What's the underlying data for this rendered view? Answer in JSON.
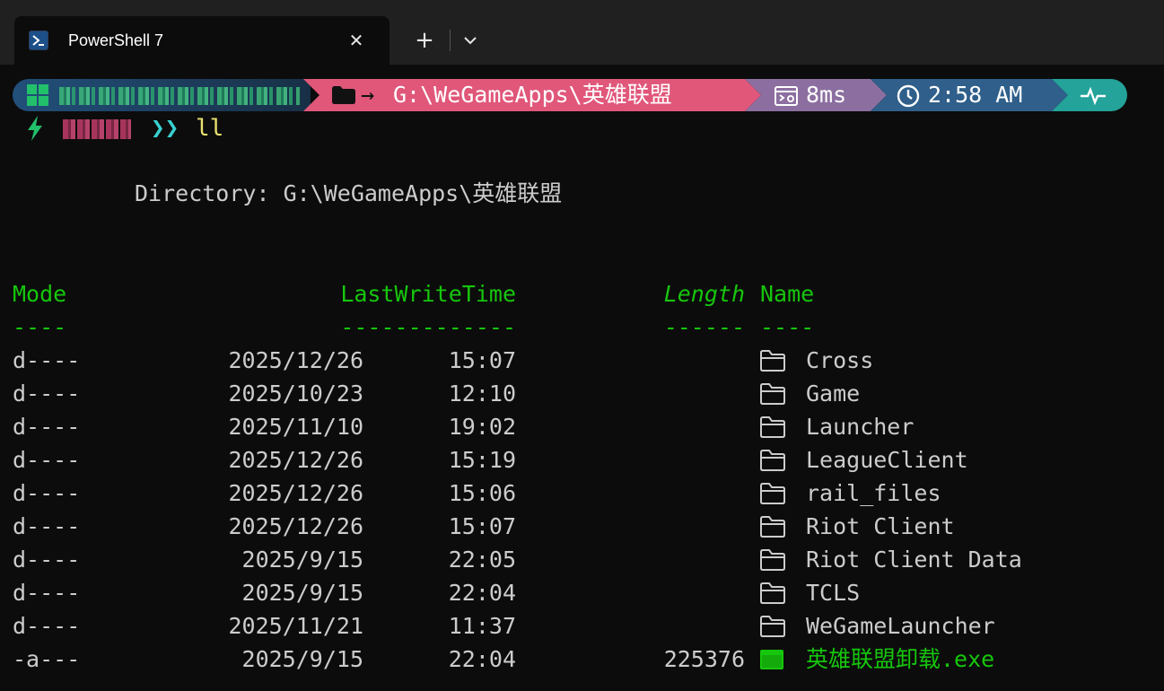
{
  "window": {
    "tab_title": "PowerShell 7",
    "tab_icon": "powershell-icon",
    "close_icon": "close-icon",
    "new_tab_icon": "plus-icon",
    "dropdown_icon": "chevron-down-icon"
  },
  "prompt": {
    "segment_host": {
      "icon": "windows-icon",
      "color": "#1d3c5c"
    },
    "segment_path": {
      "icon": "folder-icon",
      "arrow": "→",
      "path": "G:\\WeGameApps\\英雄联盟",
      "color": "#e0577a"
    },
    "segment_duration": {
      "icon": "execution-time-icon",
      "value": "8ms",
      "color": "#8c6fa0"
    },
    "segment_time": {
      "icon": "clock-icon",
      "value": "2:58 AM",
      "color": "#2f5f8a"
    },
    "segment_status": {
      "icon": "pulse-icon",
      "color": "#23a39a"
    }
  },
  "command": {
    "icon": "lightning-icon",
    "chevrons": "❯❯",
    "text": "ll"
  },
  "listing": {
    "directory_line": "Directory: G:\\WeGameApps\\英雄联盟",
    "headers": {
      "mode": "Mode",
      "lastwritetime": "LastWriteTime",
      "length": "Length",
      "name": "Name"
    },
    "underlines": {
      "mode": "----",
      "lastwritetime": "-------------",
      "length": "------",
      "name": "----"
    },
    "rows": [
      {
        "mode": "d----",
        "date": "2025/12/26",
        "time": "15:07",
        "length": "",
        "type": "folder",
        "name": "Cross"
      },
      {
        "mode": "d----",
        "date": "2025/10/23",
        "time": "12:10",
        "length": "",
        "type": "folder",
        "name": "Game"
      },
      {
        "mode": "d----",
        "date": "2025/11/10",
        "time": "19:02",
        "length": "",
        "type": "folder",
        "name": "Launcher"
      },
      {
        "mode": "d----",
        "date": "2025/12/26",
        "time": "15:19",
        "length": "",
        "type": "folder",
        "name": "LeagueClient"
      },
      {
        "mode": "d----",
        "date": "2025/12/26",
        "time": "15:06",
        "length": "",
        "type": "folder",
        "name": "rail_files"
      },
      {
        "mode": "d----",
        "date": "2025/12/26",
        "time": "15:07",
        "length": "",
        "type": "folder",
        "name": "Riot Client"
      },
      {
        "mode": "d----",
        "date": "2025/9/15",
        "time": "22:05",
        "length": "",
        "type": "folder",
        "name": "Riot Client Data"
      },
      {
        "mode": "d----",
        "date": "2025/9/15",
        "time": "22:04",
        "length": "",
        "type": "folder",
        "name": "TCLS"
      },
      {
        "mode": "d----",
        "date": "2025/11/21",
        "time": "11:37",
        "length": "",
        "type": "folder",
        "name": "WeGameLauncher"
      },
      {
        "mode": "-a---",
        "date": "2025/9/15",
        "time": "22:04",
        "length": "225376",
        "type": "exe",
        "name": "英雄联盟卸载.exe"
      }
    ]
  },
  "colors": {
    "background": "#0c0c0c",
    "header_green": "#16c60c",
    "text": "#cccccc",
    "chevron_cyan": "#3ad0d0",
    "command_yellow": "#e8e070"
  }
}
